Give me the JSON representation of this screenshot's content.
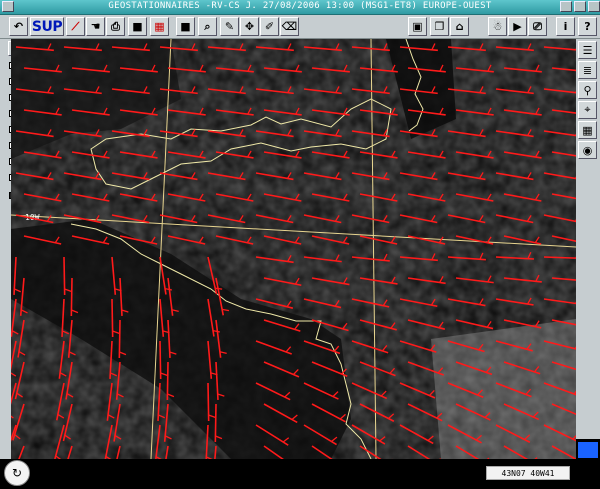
{
  "window": {
    "title": "GEOSTATIONNAIRES -RV-CS J. 27/08/2006 13:00 (MSG1-ET8) EUROPE-OUEST"
  },
  "toolbar": {
    "back_icon": "undo-arrow-icon",
    "sup_label": "SUP",
    "buttons": [
      {
        "name": "wind-barb-tool",
        "icon": "wind-barb-icon"
      },
      {
        "name": "cursor-tool",
        "icon": "pointer-icon"
      },
      {
        "name": "print-tool",
        "icon": "printer-icon"
      },
      {
        "name": "black-square-tool",
        "icon": "square-icon"
      },
      {
        "name": "palette-tool",
        "icon": "palette-icon"
      },
      {
        "name": "zoom-tool",
        "icon": "magnifier-icon"
      },
      {
        "name": "draw-tool",
        "icon": "pencil-icon"
      },
      {
        "name": "pan-tool",
        "icon": "move-icon"
      },
      {
        "name": "edit-tool",
        "icon": "edit-icon"
      },
      {
        "name": "clear-tool",
        "icon": "eraser-icon"
      }
    ],
    "right_buttons": [
      {
        "name": "frame-tool",
        "icon": "frame-icon"
      },
      {
        "name": "window-tool",
        "icon": "window-icon"
      },
      {
        "name": "map-tool",
        "icon": "map-icon"
      },
      {
        "name": "person-tool",
        "icon": "person-icon"
      },
      {
        "name": "play-tool",
        "icon": "play-icon"
      },
      {
        "name": "stop-tool",
        "icon": "stop-icon"
      },
      {
        "name": "screen-tool",
        "icon": "screen-icon"
      },
      {
        "name": "info-tool",
        "icon": "info-icon"
      },
      {
        "name": "help-tool",
        "icon": "help-icon"
      }
    ]
  },
  "right_panel": [
    {
      "name": "layers-button",
      "icon": "layers-icon"
    },
    {
      "name": "stack-button",
      "icon": "stack-icon"
    },
    {
      "name": "run-button",
      "icon": "running-man-icon"
    },
    {
      "name": "satellite-button",
      "icon": "satellite-icon"
    },
    {
      "name": "grid-button",
      "icon": "grid-icon"
    },
    {
      "name": "globe-button",
      "icon": "globe-icon"
    }
  ],
  "layers": [
    {
      "name": "layer-ring",
      "icon": "ring-icon",
      "color": "#1a8a1a"
    },
    {
      "name": "layer-whirl",
      "icon": "whirl-icon",
      "color": "#000000"
    },
    {
      "name": "layer-q",
      "icon": "q-icon",
      "color": "#000000"
    },
    {
      "name": "layer-lightning",
      "icon": "lightning-icon",
      "color": "#000000"
    },
    {
      "name": "layer-dots",
      "icon": "dots-icon",
      "color": "#000000"
    },
    {
      "name": "layer-storm",
      "icon": "storm-icon",
      "color": "#0a2ad0"
    },
    {
      "name": "layer-rain",
      "icon": "rain-icon",
      "color": "#c02020"
    },
    {
      "name": "layer-r",
      "icon": "r-icon",
      "color": "#d040d0"
    },
    {
      "name": "layer-check",
      "icon": "check-icon",
      "color": "#000000"
    }
  ],
  "map": {
    "meridian_label": "10W",
    "coord_readout": "43N07 40W41",
    "wind_color": "#ff1a1a",
    "coast_color": "#f0e9a8",
    "grid_color": "#e8d590"
  }
}
